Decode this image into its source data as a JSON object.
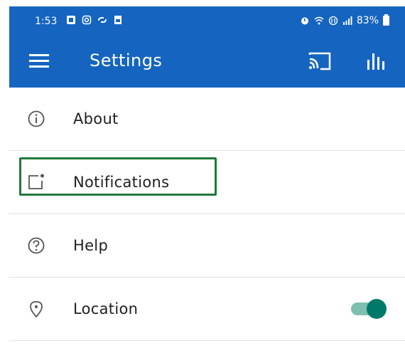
{
  "status_bar": {
    "time": "1:53",
    "battery": "83%",
    "left_icons": [
      "app-icon",
      "instagram-icon",
      "link-icon",
      "sim-icon"
    ],
    "right_icons": [
      "alarm-icon",
      "wifi-icon",
      "data-icon",
      "signal-icon",
      "battery-icon"
    ]
  },
  "app_bar": {
    "title": "Settings",
    "background": "#1565c0"
  },
  "settings": {
    "items": [
      {
        "label": "About",
        "icon": "info-icon"
      },
      {
        "label": "Notifications",
        "icon": "notification-icon"
      },
      {
        "label": "Help",
        "icon": "help-icon"
      },
      {
        "label": "Location",
        "icon": "location-icon",
        "toggle_on": true
      }
    ]
  },
  "colors": {
    "accent": "#00796b",
    "annotation": "#1f7a3a"
  }
}
